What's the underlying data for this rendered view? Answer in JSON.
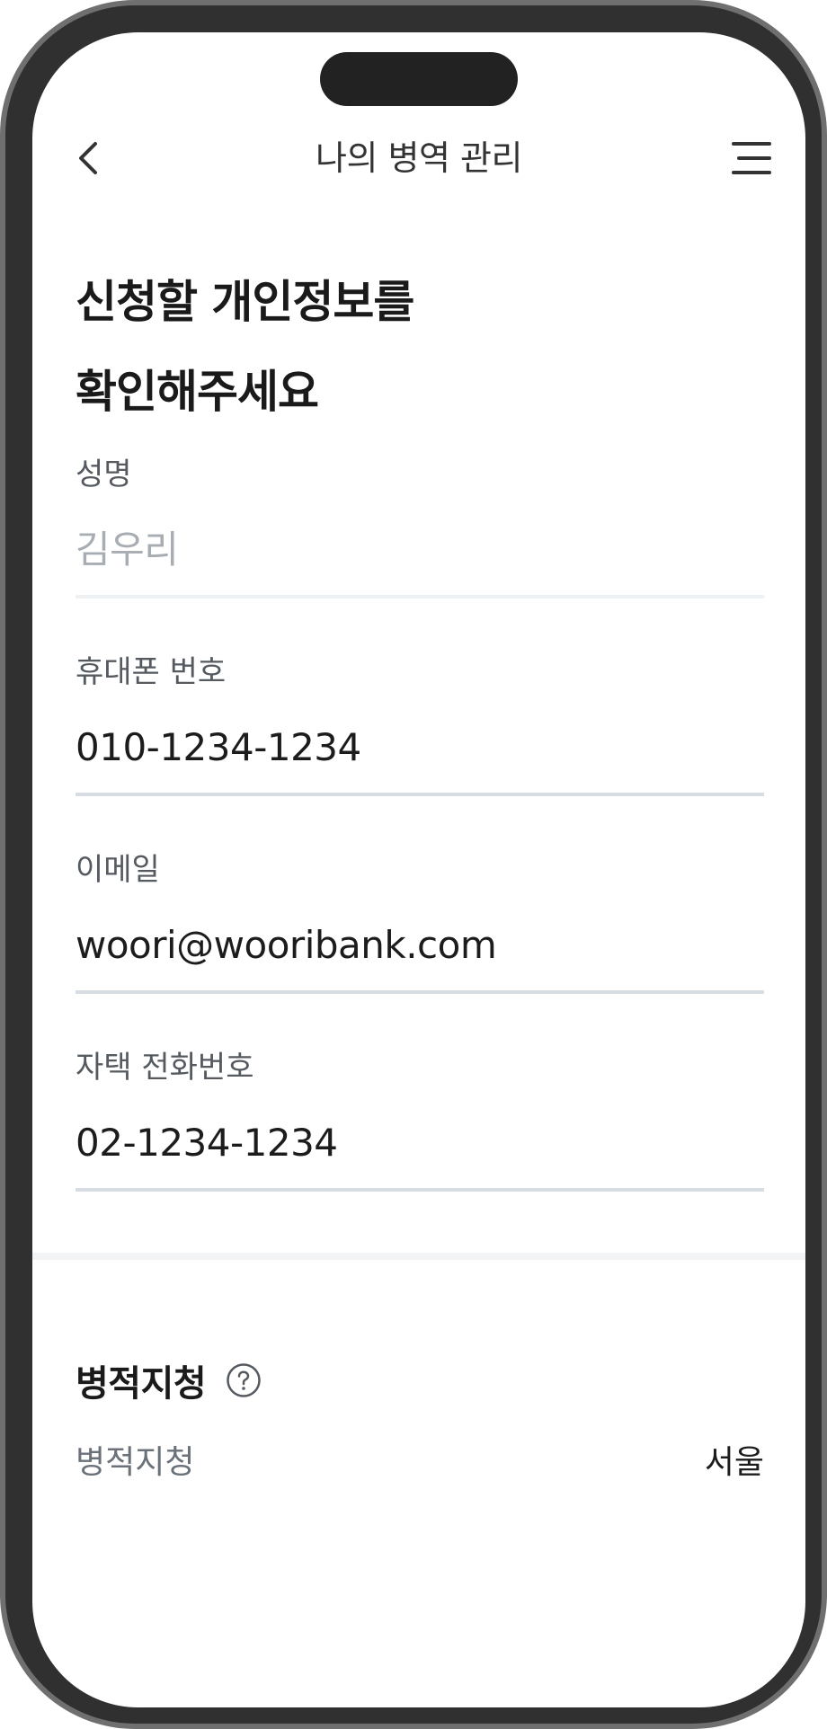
{
  "navbar": {
    "title": "나의 병역 관리",
    "back_icon": "chevron-left-icon",
    "menu_icon": "hamburger-menu-icon"
  },
  "heading": {
    "line1": "신청할 개인정보를",
    "line2": "확인해주세요"
  },
  "fields": [
    {
      "label": "성명",
      "value": "김우리",
      "editable": false
    },
    {
      "label": "휴대폰 번호",
      "value": "010-1234-1234",
      "editable": true
    },
    {
      "label": "이메일",
      "value": "woori@wooribank.com",
      "editable": true
    },
    {
      "label": "자택 전화번호",
      "value": "02-1234-1234",
      "editable": true
    }
  ],
  "section": {
    "title": "병적지청",
    "help_icon": "question-circle-icon",
    "row_label": "병적지청",
    "row_value": "서울"
  },
  "colors": {
    "text_primary": "#1c1c1c",
    "text_label": "#555a60",
    "text_placeholder": "#a7adb3",
    "underline": "#d7dde2",
    "divider": "#f2f4f6"
  }
}
